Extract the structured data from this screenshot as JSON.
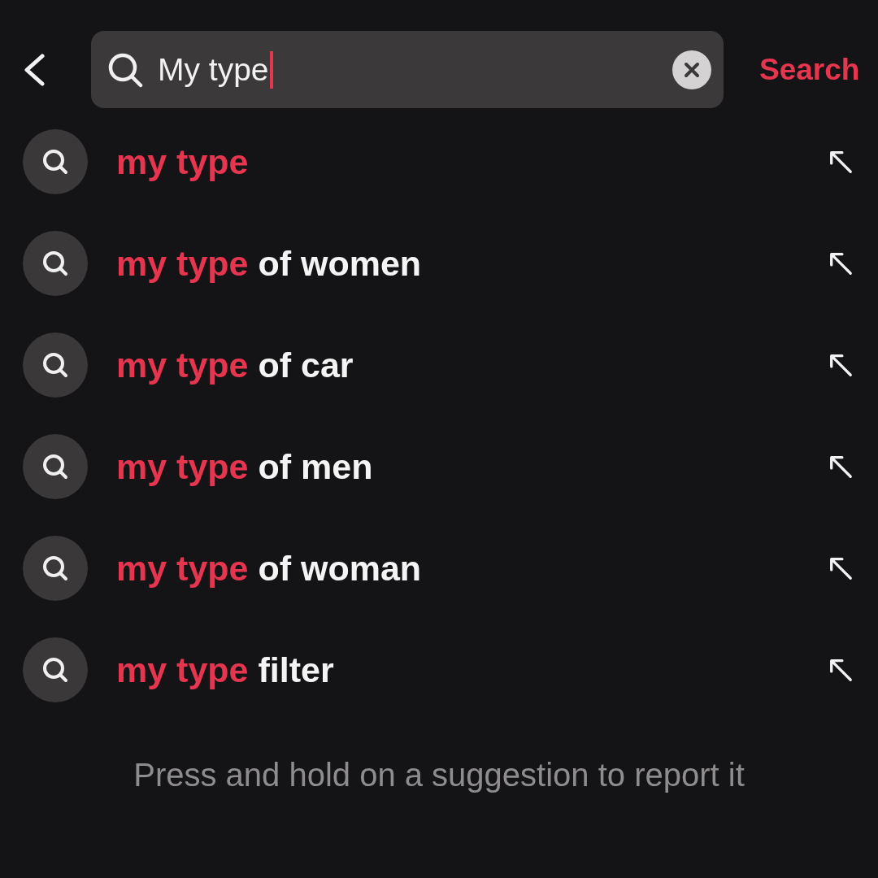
{
  "search_field": {
    "value": "My type",
    "focused": true
  },
  "search_button": "Search",
  "suggestions": [
    {
      "match": "my type"
    },
    {
      "match": "my type",
      "rest": "of women"
    },
    {
      "match": "my type",
      "rest": "of car"
    },
    {
      "match": "my type",
      "rest": "of men"
    },
    {
      "match": "my type",
      "rest": "of woman"
    },
    {
      "match": "my type",
      "rest": "filter"
    }
  ],
  "footer": "Press and hold on a suggestion to report it"
}
